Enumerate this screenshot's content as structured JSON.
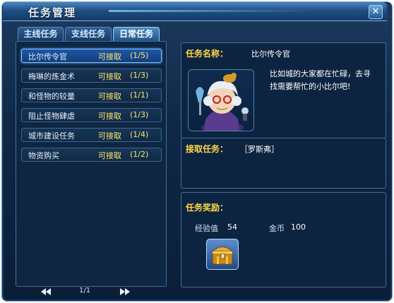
{
  "window": {
    "title": "任务管理",
    "close_glyph": "✕"
  },
  "tabs": [
    {
      "label": "主线任务",
      "active": false
    },
    {
      "label": "支线任务",
      "active": false
    },
    {
      "label": "日常任务",
      "active": true
    }
  ],
  "quests": [
    {
      "name": "比尔传令官",
      "status": "可接取",
      "count": "(1/5)",
      "selected": true
    },
    {
      "name": "梅琳的炼金术",
      "status": "可接取",
      "count": "(1/3)",
      "selected": false
    },
    {
      "name": "和怪物的较量",
      "status": "可接取",
      "count": "(1/1)",
      "selected": false
    },
    {
      "name": "阻止怪物肆虐",
      "status": "可接取",
      "count": "(1/3)",
      "selected": false
    },
    {
      "name": "城市建设任务",
      "status": "可接取",
      "count": "(1/4)",
      "selected": false
    },
    {
      "name": "物资购买",
      "status": "可接取",
      "count": "(1/2)",
      "selected": false
    }
  ],
  "pager": {
    "prev_icon": "double-left-arrow-icon",
    "next_icon": "double-right-arrow-icon",
    "page": "1/1"
  },
  "detail": {
    "name_label": "任务名称：",
    "name_value": "比尔传令官",
    "description": "比如城的大家都在忙碌，去寻找需要帮忙的小比尔吧!",
    "accept_label": "接取任务：",
    "accept_value": "［罗斯弗］",
    "reward_label": "任务奖励：",
    "exp_label": "经验值",
    "exp_value": "54",
    "gold_label": "金币",
    "gold_value": "100",
    "reward_item_icon": "treasure-chest-icon"
  },
  "colors": {
    "accent_yellow": "#ffd84a",
    "selected_blue": "#1e57a8",
    "window_bg": "#102846"
  }
}
